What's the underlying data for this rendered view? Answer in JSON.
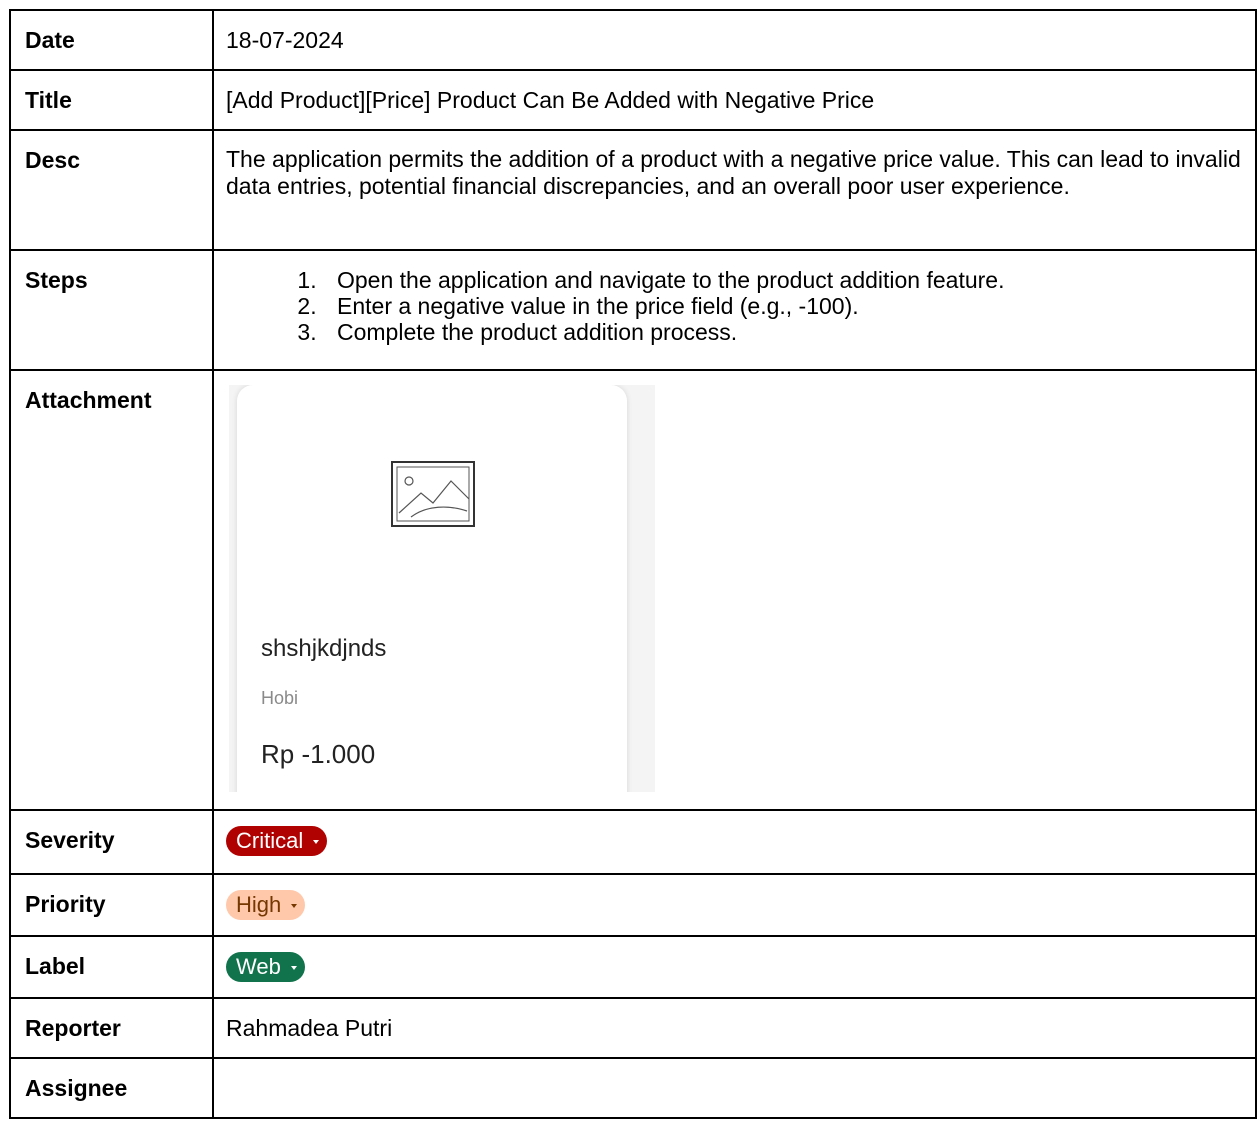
{
  "rows": {
    "date": {
      "label": "Date",
      "value": "18-07-2024"
    },
    "title": {
      "label": "Title",
      "value": "[Add Product][Price] Product Can Be Added with Negative Price"
    },
    "desc": {
      "label": "Desc",
      "value": "The application permits the addition of a product with a negative price value. This can lead to invalid data entries, potential financial discrepancies, and an overall poor user experience."
    },
    "steps": {
      "label": "Steps",
      "items": [
        "Open the application and navigate to the product addition feature.",
        "Enter a negative value in the price field (e.g., -100).",
        "Complete the product addition process."
      ]
    },
    "attachment": {
      "label": "Attachment",
      "card": {
        "image_icon": "image-placeholder-icon",
        "name": "shshjkdjnds",
        "category": "Hobi",
        "price": "Rp -1.000"
      }
    },
    "severity": {
      "label": "Severity",
      "value": "Critical",
      "color": "#b10202",
      "text_color": "#ffffff"
    },
    "priority": {
      "label": "Priority",
      "value": "High",
      "color": "#ffc8aa",
      "text_color": "#753800"
    },
    "label": {
      "label": "Label",
      "value": "Web",
      "color": "#11734b",
      "text_color": "#ffffff"
    },
    "reporter": {
      "label": "Reporter",
      "value": "Rahmadea Putri"
    },
    "assignee": {
      "label": "Assignee",
      "value": ""
    }
  }
}
